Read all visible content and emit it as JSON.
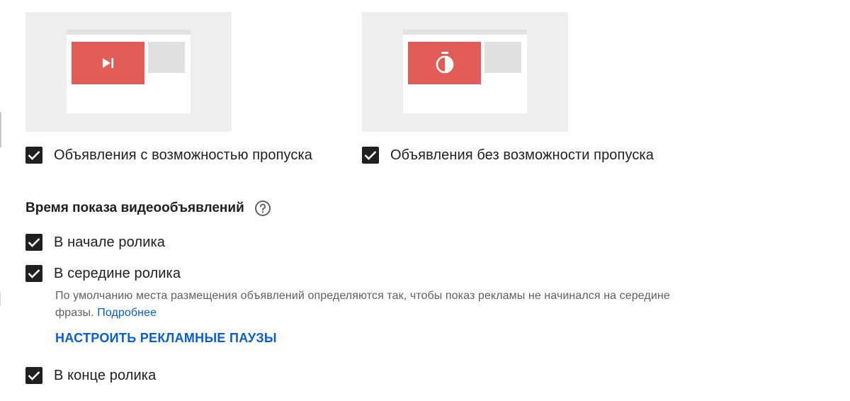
{
  "ad_formats": {
    "skippable": {
      "label": "Объявления с возможностью пропуска",
      "checked": true,
      "icon": "skip-next-icon"
    },
    "non_skippable": {
      "label": "Объявления без возможности пропуска",
      "checked": true,
      "icon": "stopwatch-icon"
    }
  },
  "timing": {
    "title": "Время показа видеообъявлений",
    "help_icon": "help-circle-icon",
    "pre_roll": {
      "label": "В начале ролика",
      "checked": true
    },
    "mid_roll": {
      "label": "В середине ролика",
      "checked": true,
      "note": "По умолчанию места размещения объявлений определяются так, чтобы показ рекламы не начинался на середине фразы.",
      "learn_more": "Подробнее",
      "configure_label": "НАСТРОИТЬ РЕКЛАМНЫЕ ПАУЗЫ"
    },
    "post_roll": {
      "label": "В конце ролика",
      "checked": true
    }
  },
  "colors": {
    "ad_red": "#e25d57",
    "link_blue": "#065fd4",
    "checkbox": "#202020",
    "card_bg": "#eeeeee"
  }
}
